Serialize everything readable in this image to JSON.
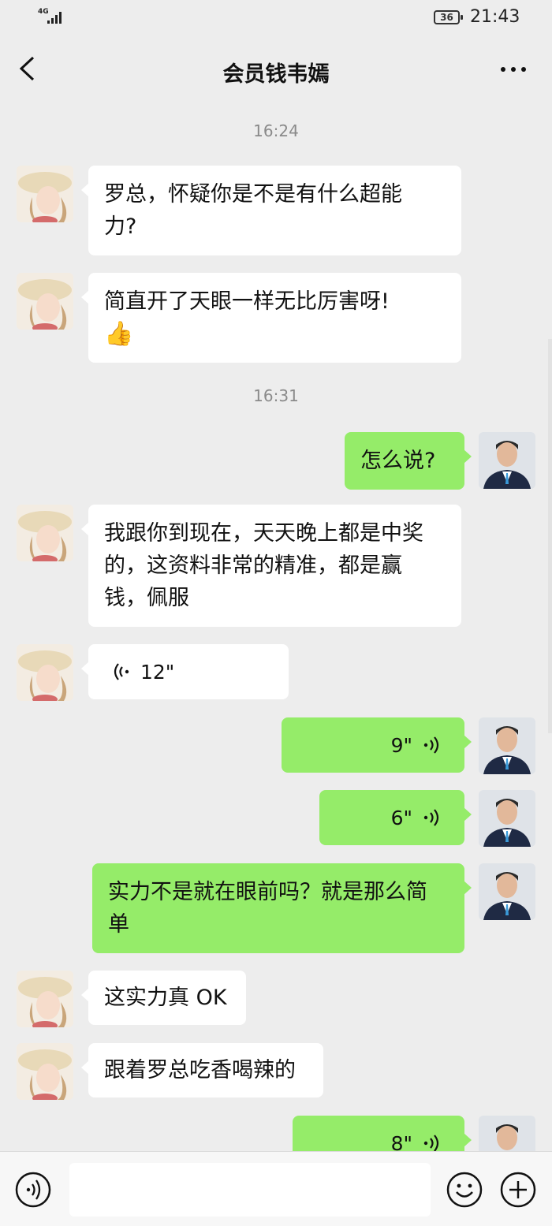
{
  "status_bar": {
    "network": "4G",
    "battery": "36",
    "time": "21:43"
  },
  "header": {
    "title": "会员钱韦嫣",
    "back_icon": "chevron-left-icon",
    "more_icon": "more-dots-icon"
  },
  "messages": {
    "t1": "16:24",
    "m1": "罗总，怀疑你是不是有什么超能",
    "m1b": "力?",
    "m2": "简直开了天眼一样无比厉害呀!",
    "m2_emoji": "👍",
    "t2": "16:31",
    "m3": "怎么说?",
    "m4a": "我跟你到现在，天天晚上都是中奖",
    "m4b": "的，这资料非常的精准，都是赢",
    "m4c": "钱，佩服",
    "v1": "12\"",
    "v2": "9\"",
    "v3": "6\"",
    "m5a": "实力不是就在眼前吗？就是那么简",
    "m5b": "单",
    "m6": "这实力真 OK",
    "m7": "跟着罗总吃香喝辣的",
    "v4": "8\""
  },
  "input_bar": {
    "text_value": "",
    "voice_icon": "voice-toggle-icon",
    "emoji_icon": "emoji-icon",
    "plus_icon": "plus-icon"
  },
  "colors": {
    "background": "#ededed",
    "outgoing_bubble": "#95ec69",
    "incoming_bubble": "#ffffff",
    "timestamp": "#8a8a8a"
  }
}
